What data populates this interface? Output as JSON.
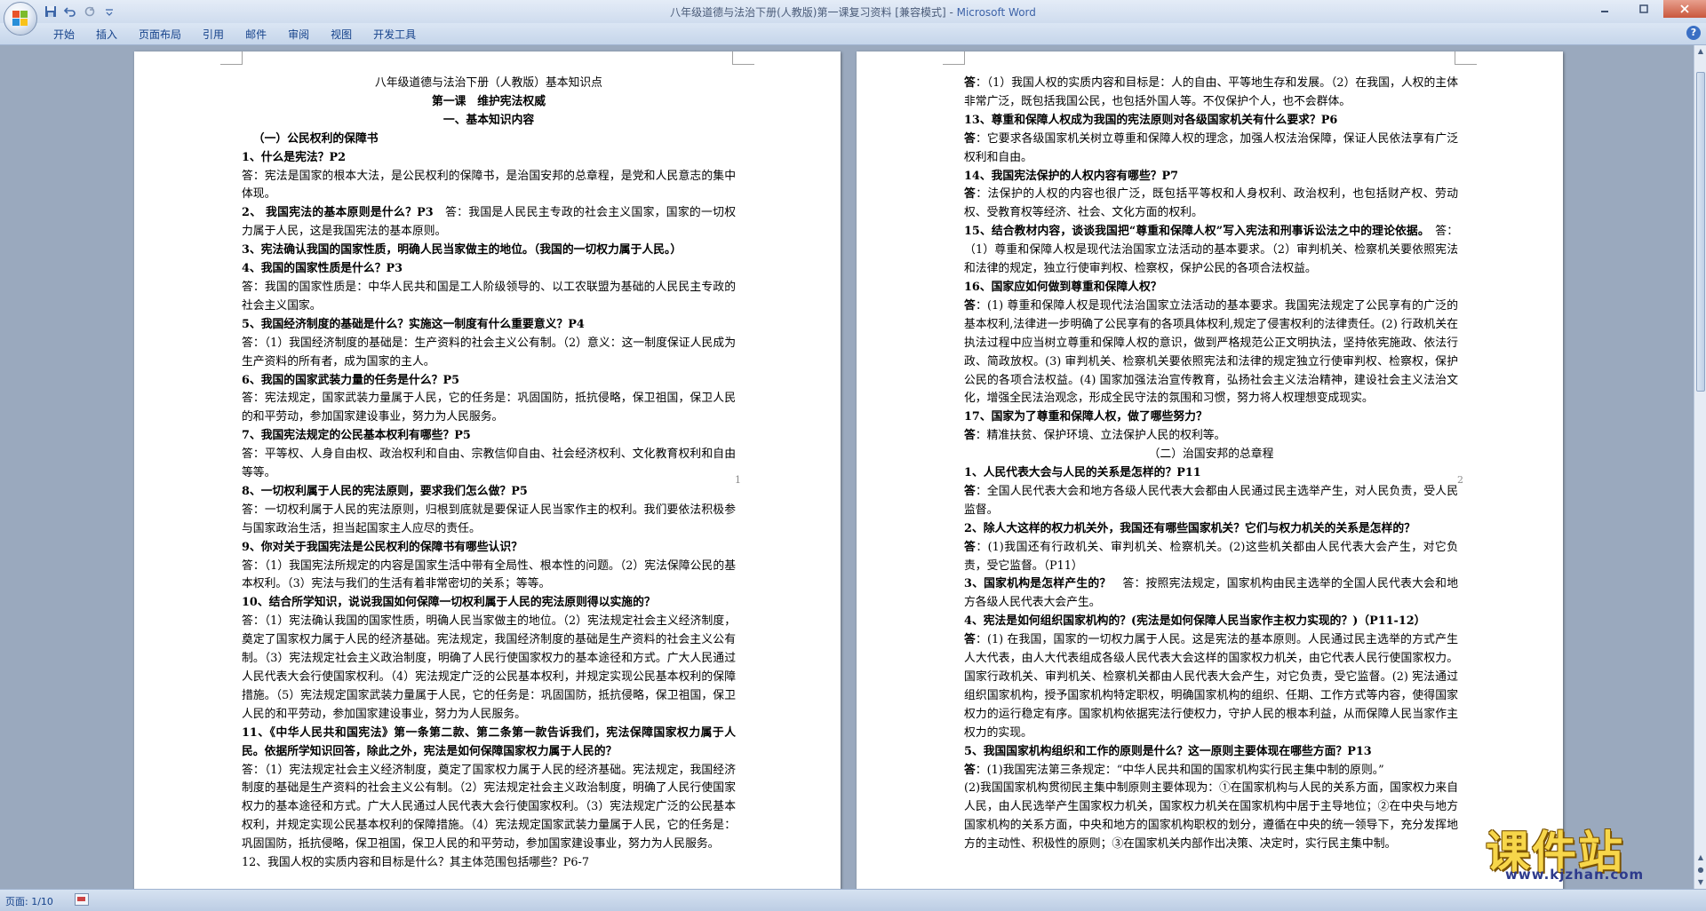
{
  "window": {
    "title": "八年级道德与法治下册(人教版)第一课复习资料 [兼容模式] - ",
    "app_name": "Microsoft Word"
  },
  "quick_access": {
    "icons": [
      "save-icon",
      "undo-icon",
      "redo-icon",
      "customize-icon"
    ]
  },
  "ribbon": {
    "tabs": [
      "开始",
      "插入",
      "页面布局",
      "引用",
      "邮件",
      "审阅",
      "视图",
      "开发工具"
    ]
  },
  "status": {
    "page_count": "页面: 1/10"
  },
  "watermark": {
    "text": "课件站",
    "url": "www.kjzhan.com"
  },
  "page1": {
    "page_number": "1",
    "lines": [
      {
        "t": "八年级道德与法治下册（人教版）基本知识点",
        "s": "c"
      },
      {
        "t": "第一课　维护宪法权威",
        "s": "c b"
      },
      {
        "t": "一、基本知识内容",
        "s": "c b"
      },
      {
        "t": "（一）公民权利的保障书",
        "s": "b ind"
      },
      {
        "t": "1、什么是宪法？P2",
        "s": "b"
      },
      {
        "t": "答：宪法是国家的根本大法，是公民权利的保障书，是治国安邦的总章程，是党和人民意志的集中体现。",
        "s": "j"
      },
      {
        "t": "2、 我国宪法的基本原则是什么？P3　答：我国是人民民主专政的社会主义国家，国家的一切权力属于人民，这是我国宪法的基本原则。",
        "s": "j",
        "bold_prefix": "2、 我国宪法的基本原则是什么？P3"
      },
      {
        "t": "3、宪法确认我国的国家性质，明确人民当家做主的地位。（我国的一切权力属于人民。）",
        "s": "b"
      },
      {
        "t": "4、我国的国家性质是什么？P3",
        "s": "b"
      },
      {
        "t": "答：我国的国家性质是：中华人民共和国是工人阶级领导的、以工农联盟为基础的人民民主专政的社会主义国家。",
        "s": "j"
      },
      {
        "t": "5、我国经济制度的基础是什么？实施这一制度有什么重要意义？P4",
        "s": "b"
      },
      {
        "t": "答：（1）我国经济制度的基础是：生产资料的社会主义公有制。（2）意义：这一制度保证人民成为生产资料的所有者，成为国家的主人。",
        "s": "j"
      },
      {
        "t": "6、我国的国家武装力量的任务是什么？P5",
        "s": "b"
      },
      {
        "t": "答：宪法规定，国家武装力量属于人民，它的任务是：巩固国防，抵抗侵略，保卫祖国，保卫人民的和平劳动，参加国家建设事业，努力为人民服务。",
        "s": "j"
      },
      {
        "t": "7、我国宪法规定的公民基本权利有哪些？P5",
        "s": "b"
      },
      {
        "t": "答：平等权、人身自由权、政治权利和自由、宗教信仰自由、社会经济权利、文化教育权利和自由等等。",
        "s": "j"
      },
      {
        "t": "8、一切权利属于人民的宪法原则，要求我们怎么做？P5",
        "s": "b"
      },
      {
        "t": "答：一切权利属于人民的宪法原则，归根到底就是要保证人民当家作主的权利。我们要依法积极参与国家政治生活，担当起国家主人应尽的责任。",
        "s": "j"
      },
      {
        "t": "9、你对关于我国宪法是公民权利的保障书有哪些认识？",
        "s": "b"
      },
      {
        "t": "答：（1）我国宪法所规定的内容是国家生活中带有全局性、根本性的问题。（2）宪法保障公民的基本权利。（3）宪法与我们的生活有着非常密切的关系；等等。",
        "s": "j"
      },
      {
        "t": "10、结合所学知识，说说我国如何保障一切权利属于人民的宪法原则得以实施的？",
        "s": "b"
      },
      {
        "t": "答：（1）宪法确认我国的国家性质，明确人民当家做主的地位。（2）宪法规定社会主义经济制度，奠定了国家权力属于人民的经济基础。宪法规定，我国经济制度的基础是生产资料的社会主义公有制。（3）宪法规定社会主义政治制度，明确了人民行使国家权力的基本途径和方式。广大人民通过人民代表大会行使国家权利。（4）宪法规定广泛的公民基本权利，并规定实现公民基本权利的保障措施。（5）宪法规定国家武装力量属于人民，它的任务是：巩固国防，抵抗侵略，保卫祖国，保卫人民的和平劳动，参加国家建设事业，努力为人民服务。",
        "s": "j"
      },
      {
        "t": "11、《中华人民共和国宪法》第一条第二款、第二条第一款告诉我们，宪法保障国家权力属于人民。依据所学知识回答，除此之外，宪法是如何保障国家权力属于人民的？",
        "s": "b j"
      },
      {
        "t": "答：（1）宪法规定社会主义经济制度，奠定了国家权力属于人民的经济基础。宪法规定，我国经济制度的基础是生产资料的社会主义公有制。（2）宪法规定社会主义政治制度，明确了人民行使国家权力的基本途径和方式。广大人民通过人民代表大会行使国家权利。（3）宪法规定广泛的公民基本权利，并规定实现公民基本权利的保障措施。（4）宪法规定国家武装力量属于人民，它的任务是：巩固国防，抵抗侵略，保卫祖国，保卫人民的和平劳动，参加国家建设事业，努力为人民服务。",
        "s": "j"
      },
      {
        "t": "12、我国人权的实质内容和目标是什么？其主体范围包括哪些？P6-7",
        "s": "",
        "bold_prefix": ""
      }
    ]
  },
  "page2": {
    "page_number": "2",
    "lines": [
      {
        "t": "答：（1）我国人权的实质内容和目标是：人的自由、平等地生存和发展。（2）在我国，人权的主体非常广泛，既包括我国公民，也包括外国人等。不仅保护个人，也不会群体。",
        "s": "j",
        "bold_prefix": "答"
      },
      {
        "t": "13、尊重和保障人权成为我国的宪法原则对各级国家机关有什么要求？P6",
        "s": "b"
      },
      {
        "t": "答：它要求各级国家机关树立尊重和保障人权的理念，加强人权法治保障，保证人民依法享有广泛权利和自由。",
        "s": "j",
        "bold_prefix": "答"
      },
      {
        "t": "14、我国宪法保护的人权内容有哪些？P7",
        "s": "b"
      },
      {
        "t": "答：法保护的人权的内容也很广泛，既包括平等权和人身权利、政治权利，也包括财产权、劳动权、受教育权等经济、社会、文化方面的权利。",
        "s": "j",
        "bold_prefix": "答"
      },
      {
        "t": "15、结合教材内容，谈谈我国把“尊重和保障人权”写入宪法和刑事诉讼法之中的理论依据。　答：（1）尊重和保障人权是现代法治国家立法活动的基本要求。（2）审判机关、检察机关要依照宪法和法律的规定，独立行使审判权、检察权，保护公民的各项合法权益。",
        "s": "j",
        "bold_prefix": "15、结合教材内容，谈谈我国把“尊重和保障人权”写入宪法和刑事诉讼法之中的理论依据。"
      },
      {
        "t": "16、国家应如何做到尊重和保障人权？",
        "s": "b"
      },
      {
        "t": "答：(1) 尊重和保障人权是现代法治国家立法活动的基本要求。我国宪法规定了公民享有的广泛的基本权利,法律进一步明确了公民享有的各项具体权利,规定了侵害权利的法律责任。(2) 行政机关在执法过程中应当树立尊重和保障人权的意识，做到严格规范公正文明执法，坚持依宪施政、依法行政、简政放权。(3) 审判机关、检察机关要依照宪法和法律的规定独立行使审判权、检察权，保护公民的各项合法权益。(4) 国家加强法治宣传教育，弘扬社会主义法治精神，建设社会主义法治文化，增强全民法治观念，形成全民守法的氛围和习惯，努力将人权理想变成现实。",
        "s": "j",
        "bold_prefix": "答"
      },
      {
        "t": "17、国家为了尊重和保障人权，做了哪些努力？",
        "s": "b"
      },
      {
        "t": "答：精准扶贫、保护环境、立法保护人民的权利等。",
        "s": "j",
        "bold_prefix": "答"
      },
      {
        "t": "（二）治国安邦的总章程",
        "s": "c"
      },
      {
        "t": "1、人民代表大会与人民的关系是怎样的？P11",
        "s": "b"
      },
      {
        "t": "答：全国人民代表大会和地方各级人民代表大会都由人民通过民主选举产生，对人民负责，受人民监督。",
        "s": "j",
        "bold_prefix": "答"
      },
      {
        "t": "2、除人大这样的权力机关外，我国还有哪些国家机关？它们与权力机关的关系是怎样的？",
        "s": "b"
      },
      {
        "t": "答：(1)我国还有行政机关、审判机关、检察机关。(2)这些机关都由人民代表大会产生，对它负责，受它监督。（P11）",
        "s": "j",
        "bold_prefix": "答"
      },
      {
        "t": "3、国家机构是怎样产生的？　答：按照宪法规定，国家机构由民主选举的全国人民代表大会和地方各级人民代表大会产生。",
        "s": "j",
        "bold_prefix": "3、国家机构是怎样产生的？"
      },
      {
        "t": "4、宪法是如何组织国家机构的？(宪法是如何保障人民当家作主权力实现的？)（P11-12）",
        "s": "b"
      },
      {
        "t": "答：(1) 在我国，国家的一切权力属于人民。这是宪法的基本原则。人民通过民主选举的方式产生人大代表，由人大代表组成各级人民代表大会这样的国家权力机关，由它代表人民行使国家权力。国家行政机关、审判机关、检察机关都由人民代表大会产生，对它负责，受它监督。(2) 宪法通过组织国家机构，授予国家机构特定职权，明确国家机构的组织、任期、工作方式等内容，使得国家权力的运行稳定有序。国家机构依据宪法行使权力，守护人民的根本利益，从而保障人民当家作主权力的实现。",
        "s": "j",
        "bold_prefix": "答"
      },
      {
        "t": "5、我国国家机构组织和工作的原则是什么？这一原则主要体现在哪些方面？P13",
        "s": "b"
      },
      {
        "t": "答：(1)我国宪法第三条规定：“中华人民共和国的国家机构实行民主集中制的原则。”",
        "s": "j",
        "bold_prefix": "答"
      },
      {
        "t": "(2)我国国家机构贯彻民主集中制原则主要体现为：①在国家机构与人民的关系方面，国家权力来自人民，由人民选举产生国家权力机关，国家权力机关在国家机构中居于主导地位；②在中央与地方国家机构的关系方面，中央和地方的国家机构职权的划分，遵循在中央的统一领导下，充分发挥地方的主动性、积极性的原则；③在国家机关内部作出决策、决定时，实行民主集中制。",
        "s": "j"
      }
    ]
  }
}
